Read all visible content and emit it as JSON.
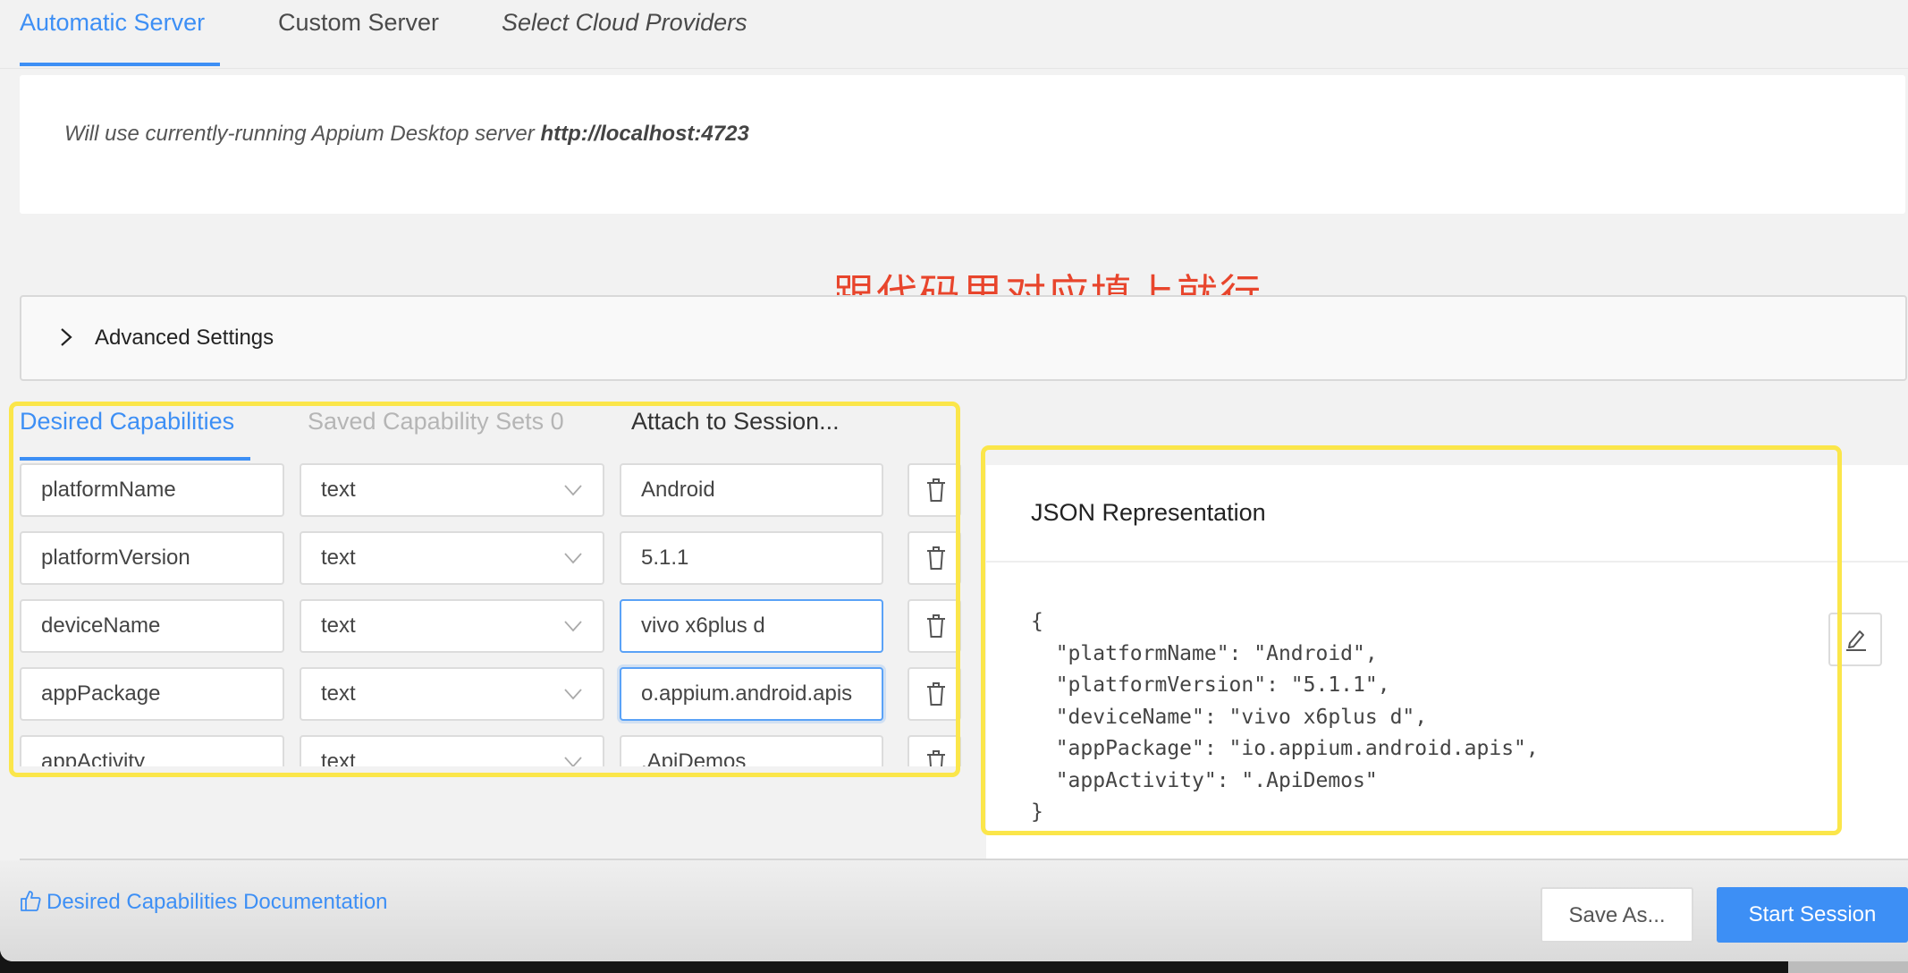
{
  "server_tabs": [
    {
      "label": "Automatic Server",
      "active": true
    },
    {
      "label": "Custom Server",
      "active": false
    },
    {
      "label": "Select Cloud Providers",
      "active": false
    }
  ],
  "server_info": {
    "prefix": "Will use currently-running Appium Desktop server ",
    "url": "http://localhost:4723"
  },
  "advanced_settings": {
    "label": "Advanced Settings",
    "icon": "chevron-right-icon",
    "expanded": false
  },
  "annotation": {
    "text": "跟代码里对应填上就行",
    "color": "#e8452c"
  },
  "capability_tabs": [
    {
      "label": "Desired Capabilities",
      "active": true
    },
    {
      "label": "Saved Capability Sets 0",
      "active": false,
      "disabled": true
    },
    {
      "label": "Attach to Session...",
      "active": false
    }
  ],
  "capabilities": [
    {
      "name": "platformName",
      "type": "text",
      "value": "Android"
    },
    {
      "name": "platformVersion",
      "type": "text",
      "value": "5.1.1"
    },
    {
      "name": "deviceName",
      "type": "text",
      "value": "vivo x6plus d"
    },
    {
      "name": "appPackage",
      "type": "text",
      "value": "o.appium.android.apis"
    },
    {
      "name": "appActivity",
      "type": "text",
      "value": ".ApiDemos"
    }
  ],
  "json_panel": {
    "title": "JSON Representation",
    "code": "{\n  \"platformName\": \"Android\",\n  \"platformVersion\": \"5.1.1\",\n  \"deviceName\": \"vivo x6plus d\",\n  \"appPackage\": \"io.appium.android.apis\",\n  \"appActivity\": \".ApiDemos\"\n}"
  },
  "footer": {
    "doc_link": "Desired Capabilities Documentation",
    "save_as": "Save As...",
    "start_session": "Start Session"
  },
  "colors": {
    "accent": "#3d8ff5",
    "highlight": "#fbe64a"
  }
}
